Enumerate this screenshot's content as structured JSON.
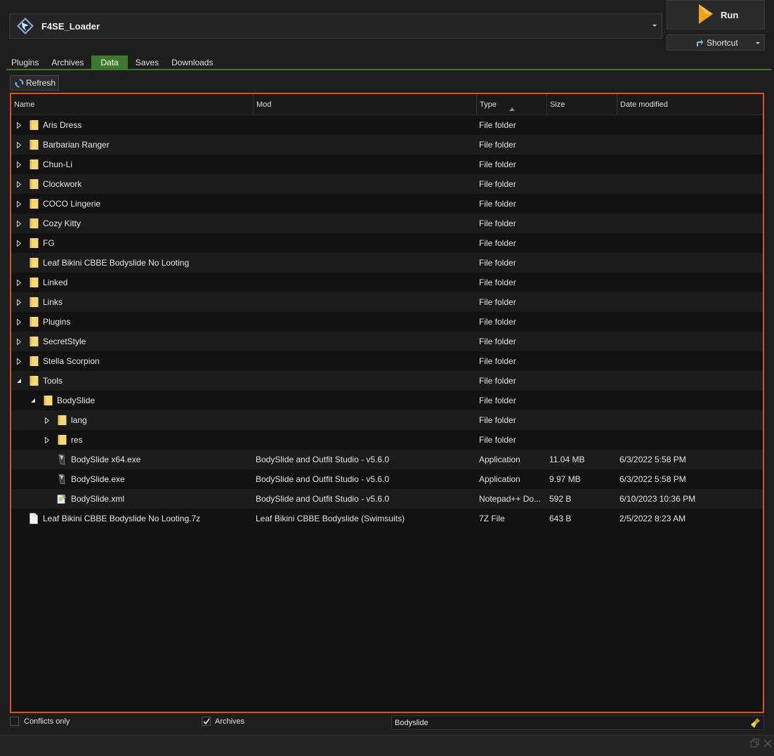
{
  "executable": {
    "name": "F4SE_Loader",
    "icon": "f4se-icon"
  },
  "run_button": {
    "label": "Run",
    "icon": "play-icon"
  },
  "shortcut_button": {
    "label": "Shortcut",
    "icon": "shortcut-arrow-icon"
  },
  "tabs": [
    {
      "label": "Plugins",
      "active": false
    },
    {
      "label": "Archives",
      "active": false
    },
    {
      "label": "Data",
      "active": true
    },
    {
      "label": "Saves",
      "active": false
    },
    {
      "label": "Downloads",
      "active": false
    }
  ],
  "refresh_button": {
    "label": "Refresh",
    "icon": "refresh-icon"
  },
  "colors": {
    "accent_green": "#3d7a2e",
    "highlight_border": "#d9531e",
    "folder": "#f5d97a"
  },
  "tree": {
    "columns": [
      {
        "label": "Name"
      },
      {
        "label": "Mod"
      },
      {
        "label": "Type",
        "sorted": "ascending"
      },
      {
        "label": "Size"
      },
      {
        "label": "Date modified"
      }
    ],
    "rows": [
      {
        "depth": 0,
        "expander": "collapsed",
        "icon": "folder-icon",
        "name": "Aris Dress",
        "mod": "",
        "type": "File folder",
        "size": "",
        "date": ""
      },
      {
        "depth": 0,
        "expander": "collapsed",
        "icon": "folder-icon",
        "name": "Barbarian Ranger",
        "mod": "",
        "type": "File folder",
        "size": "",
        "date": ""
      },
      {
        "depth": 0,
        "expander": "collapsed",
        "icon": "folder-icon",
        "name": "Chun-Li",
        "mod": "",
        "type": "File folder",
        "size": "",
        "date": ""
      },
      {
        "depth": 0,
        "expander": "collapsed",
        "icon": "folder-icon",
        "name": "Clockwork",
        "mod": "",
        "type": "File folder",
        "size": "",
        "date": ""
      },
      {
        "depth": 0,
        "expander": "collapsed",
        "icon": "folder-icon",
        "name": "COCO Lingerie",
        "mod": "",
        "type": "File folder",
        "size": "",
        "date": ""
      },
      {
        "depth": 0,
        "expander": "collapsed",
        "icon": "folder-icon",
        "name": "Cozy Kitty",
        "mod": "",
        "type": "File folder",
        "size": "",
        "date": ""
      },
      {
        "depth": 0,
        "expander": "collapsed",
        "icon": "folder-icon",
        "name": "FG",
        "mod": "",
        "type": "File folder",
        "size": "",
        "date": ""
      },
      {
        "depth": 0,
        "expander": "none",
        "icon": "folder-icon",
        "name": "Leaf Bikini CBBE Bodyslide No Looting",
        "mod": "",
        "type": "File folder",
        "size": "",
        "date": ""
      },
      {
        "depth": 0,
        "expander": "collapsed",
        "icon": "folder-icon",
        "name": "Linked",
        "mod": "",
        "type": "File folder",
        "size": "",
        "date": ""
      },
      {
        "depth": 0,
        "expander": "collapsed",
        "icon": "folder-icon",
        "name": "Links",
        "mod": "",
        "type": "File folder",
        "size": "",
        "date": ""
      },
      {
        "depth": 0,
        "expander": "collapsed",
        "icon": "folder-icon",
        "name": "Plugins",
        "mod": "",
        "type": "File folder",
        "size": "",
        "date": ""
      },
      {
        "depth": 0,
        "expander": "collapsed",
        "icon": "folder-icon",
        "name": "SecretStyle",
        "mod": "",
        "type": "File folder",
        "size": "",
        "date": ""
      },
      {
        "depth": 0,
        "expander": "collapsed",
        "icon": "folder-icon",
        "name": "Stella Scorpion",
        "mod": "",
        "type": "File folder",
        "size": "",
        "date": ""
      },
      {
        "depth": 0,
        "expander": "expanded",
        "icon": "folder-icon",
        "name": "Tools",
        "mod": "",
        "type": "File folder",
        "size": "",
        "date": ""
      },
      {
        "depth": 1,
        "expander": "expanded",
        "icon": "folder-icon",
        "name": "BodySlide",
        "mod": "",
        "type": "File folder",
        "size": "",
        "date": ""
      },
      {
        "depth": 2,
        "expander": "collapsed",
        "icon": "folder-icon",
        "name": "lang",
        "mod": "",
        "type": "File folder",
        "size": "",
        "date": ""
      },
      {
        "depth": 2,
        "expander": "collapsed",
        "icon": "folder-icon",
        "name": "res",
        "mod": "",
        "type": "File folder",
        "size": "",
        "date": ""
      },
      {
        "depth": 2,
        "expander": "none",
        "icon": "exe-icon",
        "name": "BodySlide x64.exe",
        "mod": "BodySlide and Outfit Studio - v5.6.0",
        "type": "Application",
        "size": "11.04 MB",
        "date": "6/3/2022 5:58 PM"
      },
      {
        "depth": 2,
        "expander": "none",
        "icon": "exe-icon",
        "name": "BodySlide.exe",
        "mod": "BodySlide and Outfit Studio - v5.6.0",
        "type": "Application",
        "size": "9.97 MB",
        "date": "6/3/2022 5:58 PM"
      },
      {
        "depth": 2,
        "expander": "none",
        "icon": "notepad-icon",
        "name": "BodySlide.xml",
        "mod": "BodySlide and Outfit Studio - v5.6.0",
        "type": "Notepad++ Do...",
        "size": "592 B",
        "date": "6/10/2023 10:36 PM"
      },
      {
        "depth": 0,
        "expander": "none",
        "icon": "file-icon",
        "name": "Leaf Bikini CBBE Bodyslide No Looting.7z",
        "mod": "Leaf Bikini CBBE Bodyslide (Swimsuits)",
        "type": "7Z File",
        "size": "643 B",
        "date": "2/5/2022 8:23 AM"
      }
    ]
  },
  "bottom": {
    "conflicts_only": {
      "label": "Conflicts only",
      "checked": false
    },
    "archives": {
      "label": "Archives",
      "checked": true
    },
    "filter": {
      "value": "Bodyslide",
      "icon": "broom-icon"
    }
  }
}
